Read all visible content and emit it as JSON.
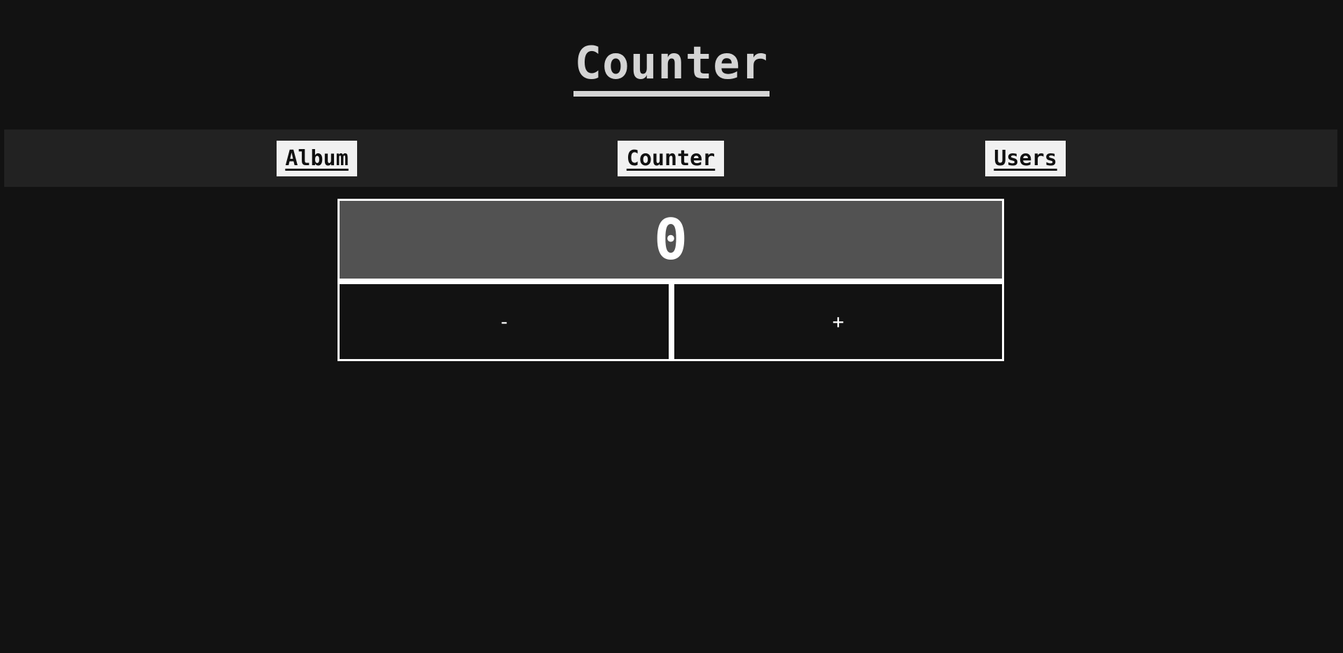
{
  "header": {
    "title": "Counter"
  },
  "nav": {
    "items": [
      {
        "label": "Album"
      },
      {
        "label": "Counter"
      },
      {
        "label": "Users"
      }
    ]
  },
  "counter": {
    "value": "0",
    "decrement_label": "-",
    "increment_label": "+"
  },
  "colors": {
    "background": "#121212",
    "nav_background": "#222222",
    "nav_link_background": "#f1f1f1",
    "counter_display": "#525252",
    "border": "#ffffff"
  }
}
